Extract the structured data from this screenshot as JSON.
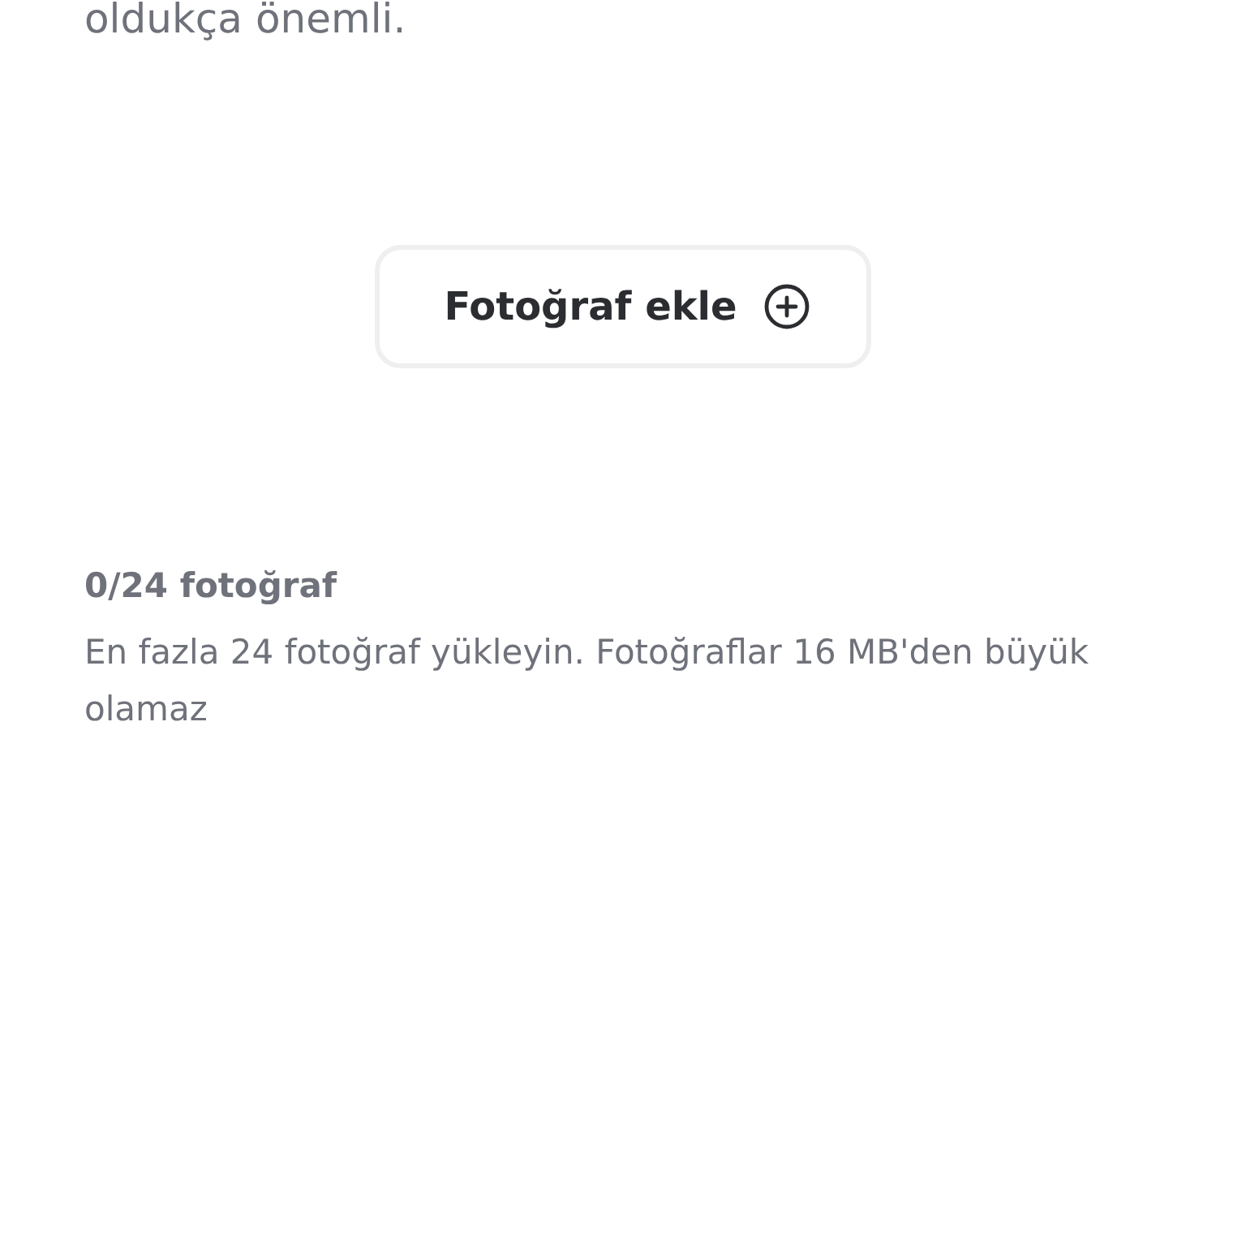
{
  "intro_text": "oldukça önemli.",
  "add_photo_button": {
    "label": "Fotoğraf ekle"
  },
  "photo_count": "0/24 fotoğraf",
  "hint": "En fazla 24 fotoğraf yükleyin. Fotoğraflar 16 MB'den büyük olamaz"
}
